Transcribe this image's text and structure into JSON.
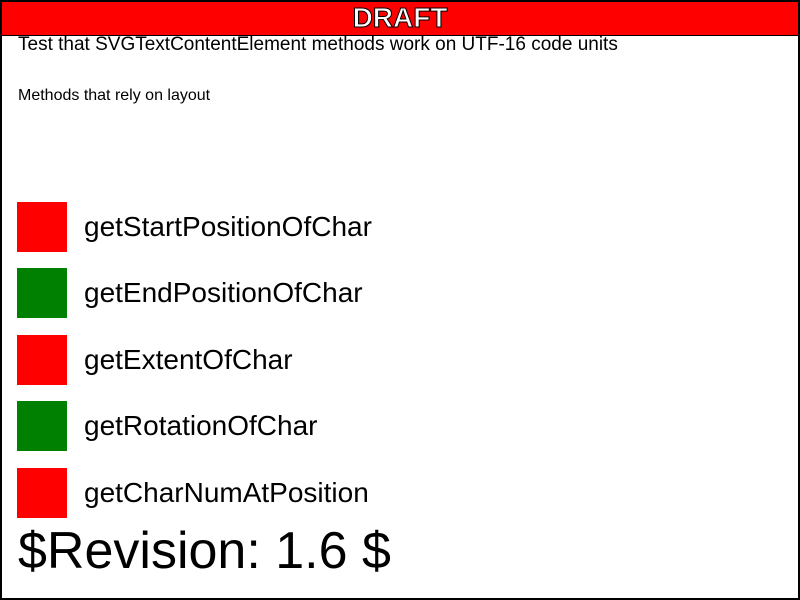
{
  "banner": {
    "label": "DRAFT",
    "color": "#ff0000"
  },
  "heading": "Test that SVGTextContentElement methods work on UTF-16 code units",
  "subheading": "Methods that rely on layout",
  "results": [
    {
      "label": "getStartPositionOfChar",
      "status": "fail",
      "color": "#ff0000"
    },
    {
      "label": "getEndPositionOfChar",
      "status": "pass",
      "color": "#008000"
    },
    {
      "label": "getExtentOfChar",
      "status": "fail",
      "color": "#ff0000"
    },
    {
      "label": "getRotationOfChar",
      "status": "pass",
      "color": "#008000"
    },
    {
      "label": "getCharNumAtPosition",
      "status": "fail",
      "color": "#ff0000"
    }
  ],
  "revision": "$Revision: 1.6 $"
}
